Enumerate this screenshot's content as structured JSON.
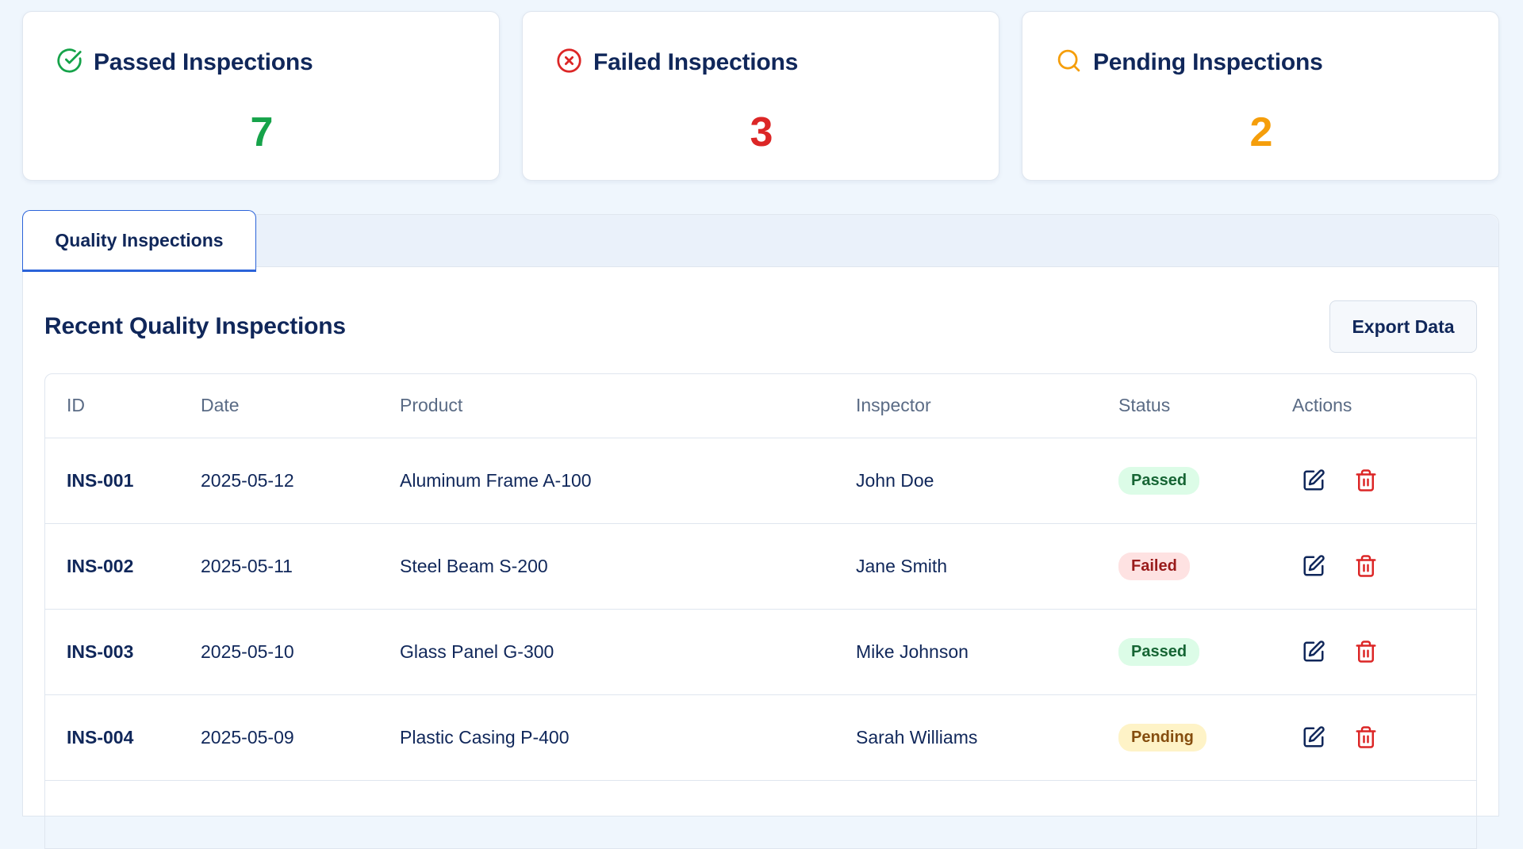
{
  "colors": {
    "passed": "#16a34a",
    "failed": "#dc2626",
    "pending": "#f59e0b",
    "accent": "#2b63d9"
  },
  "stats": [
    {
      "title": "Passed Inspections",
      "value": "7",
      "icon": "check-circle-icon"
    },
    {
      "title": "Failed Inspections",
      "value": "3",
      "icon": "x-circle-icon"
    },
    {
      "title": "Pending Inspections",
      "value": "2",
      "icon": "search-icon"
    }
  ],
  "tabs": [
    {
      "label": "Quality Inspections",
      "active": true
    }
  ],
  "section": {
    "title": "Recent Quality Inspections",
    "export_label": "Export Data"
  },
  "table": {
    "columns": [
      "ID",
      "Date",
      "Product",
      "Inspector",
      "Status",
      "Actions"
    ],
    "rows": [
      {
        "id": "INS-001",
        "date": "2025-05-12",
        "product": "Aluminum Frame A-100",
        "inspector": "John Doe",
        "status": "Passed"
      },
      {
        "id": "INS-002",
        "date": "2025-05-11",
        "product": "Steel Beam S-200",
        "inspector": "Jane Smith",
        "status": "Failed"
      },
      {
        "id": "INS-003",
        "date": "2025-05-10",
        "product": "Glass Panel G-300",
        "inspector": "Mike Johnson",
        "status": "Passed"
      },
      {
        "id": "INS-004",
        "date": "2025-05-09",
        "product": "Plastic Casing P-400",
        "inspector": "Sarah Williams",
        "status": "Pending"
      }
    ],
    "row_actions": [
      "edit-icon",
      "trash-icon"
    ]
  }
}
